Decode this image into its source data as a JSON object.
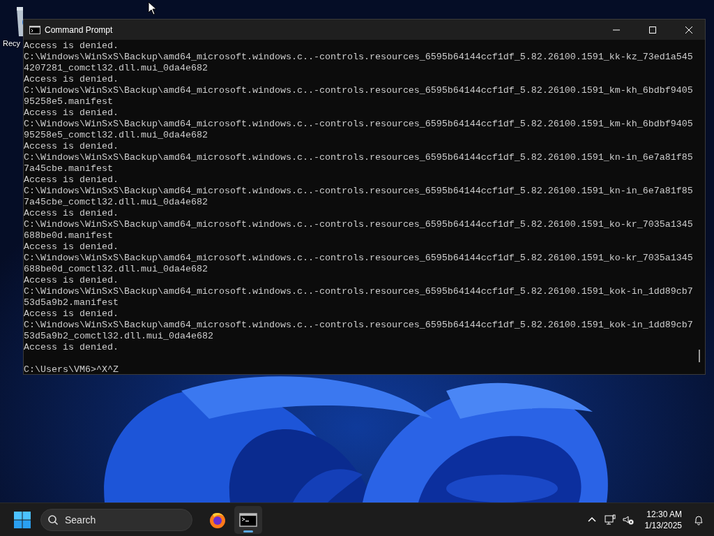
{
  "desktop": {
    "icons": [
      {
        "label": "Recy"
      }
    ]
  },
  "window": {
    "title": "Command Prompt",
    "console": {
      "lines": [
        "Access is denied.",
        "C:\\Windows\\WinSxS\\Backup\\amd64_microsoft.windows.c..-controls.resources_6595b64144ccf1df_5.82.26100.1591_kk-kz_73ed1a545",
        "4207281_comctl32.dll.mui_0da4e682",
        "Access is denied.",
        "C:\\Windows\\WinSxS\\Backup\\amd64_microsoft.windows.c..-controls.resources_6595b64144ccf1df_5.82.26100.1591_km-kh_6bdbf9405",
        "95258e5.manifest",
        "Access is denied.",
        "C:\\Windows\\WinSxS\\Backup\\amd64_microsoft.windows.c..-controls.resources_6595b64144ccf1df_5.82.26100.1591_km-kh_6bdbf9405",
        "95258e5_comctl32.dll.mui_0da4e682",
        "Access is denied.",
        "C:\\Windows\\WinSxS\\Backup\\amd64_microsoft.windows.c..-controls.resources_6595b64144ccf1df_5.82.26100.1591_kn-in_6e7a81f85",
        "7a45cbe.manifest",
        "Access is denied.",
        "C:\\Windows\\WinSxS\\Backup\\amd64_microsoft.windows.c..-controls.resources_6595b64144ccf1df_5.82.26100.1591_kn-in_6e7a81f85",
        "7a45cbe_comctl32.dll.mui_0da4e682",
        "Access is denied.",
        "C:\\Windows\\WinSxS\\Backup\\amd64_microsoft.windows.c..-controls.resources_6595b64144ccf1df_5.82.26100.1591_ko-kr_7035a1345",
        "688be0d.manifest",
        "Access is denied.",
        "C:\\Windows\\WinSxS\\Backup\\amd64_microsoft.windows.c..-controls.resources_6595b64144ccf1df_5.82.26100.1591_ko-kr_7035a1345",
        "688be0d_comctl32.dll.mui_0da4e682",
        "Access is denied.",
        "C:\\Windows\\WinSxS\\Backup\\amd64_microsoft.windows.c..-controls.resources_6595b64144ccf1df_5.82.26100.1591_kok-in_1dd89cb7",
        "53d5a9b2.manifest",
        "Access is denied.",
        "C:\\Windows\\WinSxS\\Backup\\amd64_microsoft.windows.c..-controls.resources_6595b64144ccf1df_5.82.26100.1591_kok-in_1dd89cb7",
        "53d5a9b2_comctl32.dll.mui_0da4e682",
        "Access is denied."
      ],
      "prompt": "C:\\Users\\VM6>^X^Z"
    }
  },
  "taskbar": {
    "search": {
      "placeholder": "Search"
    },
    "apps": [
      {
        "kind": "browser",
        "selected": false
      },
      {
        "kind": "terminal",
        "selected": true
      }
    ],
    "clock": {
      "time": "12:30 AM",
      "date": "1/13/2025"
    }
  }
}
